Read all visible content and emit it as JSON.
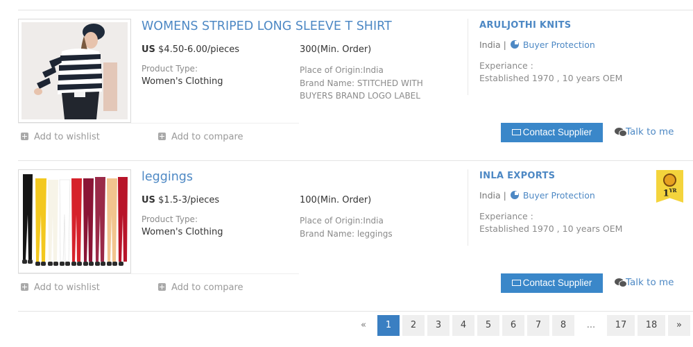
{
  "products": [
    {
      "title": "WOMENS STRIPED LONG SLEEVE T SHIRT",
      "currency": "US",
      "price": "$4.50-6.00/pieces",
      "moq": "300(Min. Order)",
      "product_type_label": "Product Type:",
      "product_type": "Women's Clothing",
      "origin": "Place of Origin:India",
      "brand": "Brand Name: STITCHED WITH BUYERS BRAND LOGO LABEL",
      "supplier": "ARULJOTHI KNITS",
      "country": "India |",
      "buyer_protection": "Buyer Protection",
      "experience_label": "Experiance :",
      "experience": "Established 1970 , 10 years OEM",
      "wishlist": "Add to wishlist",
      "compare": "Add to compare",
      "contact": "Contact Supplier",
      "talk": "Talk to me",
      "badge": null
    },
    {
      "title": "leggings",
      "currency": "US",
      "price": "$1.5-3/pieces",
      "moq": "100(Min. Order)",
      "product_type_label": "Product Type:",
      "product_type": "Women's Clothing",
      "origin": "Place of Origin:India",
      "brand": "Brand Name: leggings",
      "supplier": "INLA EXPORTS",
      "country": "India |",
      "buyer_protection": "Buyer Protection",
      "experience_label": "Experiance :",
      "experience": "Established 1970 , 10 years OEM",
      "wishlist": "Add to wishlist",
      "compare": "Add to compare",
      "contact": "Contact Supplier",
      "talk": "Talk to me",
      "badge": {
        "years": "1",
        "unit": "YR"
      }
    }
  ],
  "pagination": {
    "prev": "«",
    "pages": [
      "1",
      "2",
      "3",
      "4",
      "5",
      "6",
      "7",
      "8"
    ],
    "ellipsis": "...",
    "tail": [
      "17",
      "18"
    ],
    "next": "»",
    "active": "1"
  },
  "colors": {
    "link": "#4d88c4",
    "button": "#3a87c9",
    "active_page": "#3a7fc2",
    "badge": "#f4d43c"
  }
}
